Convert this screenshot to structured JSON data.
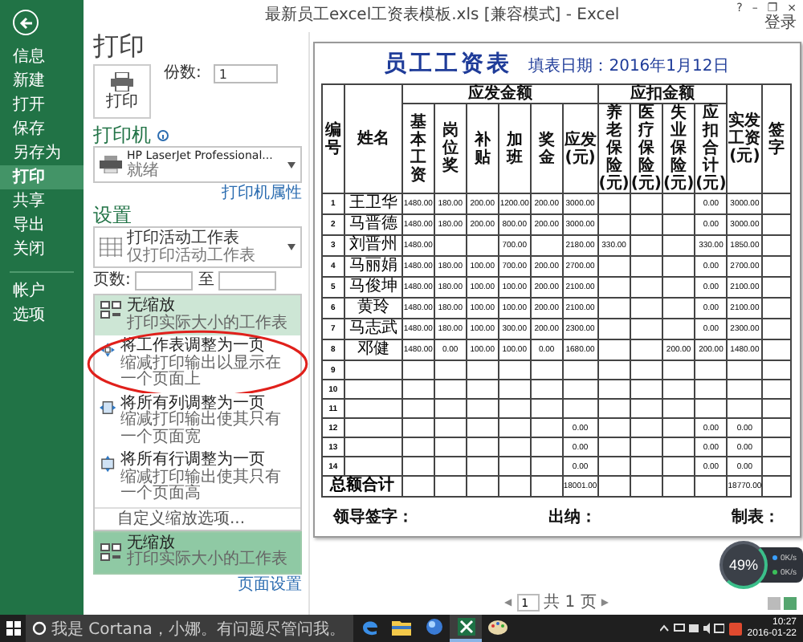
{
  "window": {
    "title": "最新员工excel工资表模板.xls [兼容模式] - Excel",
    "controls": [
      "?",
      "–",
      "❐",
      "×"
    ],
    "sign_in": "登录"
  },
  "nav": {
    "items": [
      {
        "label": "信息",
        "selected": false
      },
      {
        "label": "新建",
        "selected": false
      },
      {
        "label": "打开",
        "selected": false
      },
      {
        "label": "保存",
        "selected": false
      },
      {
        "label": "另存为",
        "selected": false
      },
      {
        "label": "打印",
        "selected": true
      },
      {
        "label": "共享",
        "selected": false
      },
      {
        "label": "导出",
        "selected": false
      },
      {
        "label": "关闭",
        "selected": false
      }
    ],
    "bottom_items": [
      {
        "label": "帐户",
        "selected": false
      },
      {
        "label": "选项",
        "selected": false
      }
    ]
  },
  "print": {
    "title": "打印",
    "button": "打印",
    "copies_label": "份数:",
    "copies": "1",
    "printer_heading": "打印机",
    "printer": {
      "name": "HP LaserJet Professional...",
      "status": "就绪"
    },
    "printer_link": "打印机属性",
    "settings_heading": "设置",
    "scope": {
      "title": "打印活动工作表",
      "subtitle": "仅打印活动工作表"
    },
    "pages_label": "页数:",
    "pages_to": "至",
    "scaling_menu": {
      "items": [
        {
          "kind": "none",
          "title": "无缩放",
          "description": "打印实际大小的工作表",
          "selected": true,
          "circled": false
        },
        {
          "kind": "fit_sheet",
          "title": "将工作表调整为一页",
          "description": "缩减打印输出以显示在一个页面上",
          "selected": false,
          "circled": true
        },
        {
          "kind": "fit_columns",
          "title": "将所有列调整为一页",
          "description": "缩减打印输出使其只有一个页面宽",
          "selected": false,
          "circled": false
        },
        {
          "kind": "fit_rows",
          "title": "将所有行调整为一页",
          "description": "缩减打印输出使其只有一个页面高",
          "selected": false,
          "circled": false
        }
      ],
      "custom": "自定义缩放选项..."
    },
    "scaling": {
      "title": "无缩放",
      "description": "打印实际大小的工作表",
      "open": true
    },
    "page_setup_link": "页面设置"
  },
  "sheet": {
    "title": "员工工资表",
    "subtitle": "填表日期：2016年1月12日",
    "header": [
      {
        "label": "编号"
      },
      {
        "label": "姓名"
      },
      {
        "label": "应发金额",
        "columns": [
          "基本工资",
          "岗位奖",
          "补贴",
          "加班",
          "奖金",
          "应发(元)"
        ]
      },
      {
        "label": "应扣金额",
        "columns": [
          "养老保险(元)",
          "医疗保险(元)",
          "失业保险(元)",
          "应扣合计(元)"
        ]
      },
      {
        "label": "实发工资(元)"
      },
      {
        "label": "签字"
      }
    ],
    "rows": [
      {
        "cells": [
          "1",
          "王卫华",
          "1480.00",
          "180.00",
          "200.00",
          "1200.00",
          "200.00",
          "3000.00",
          null,
          null,
          null,
          "0.00",
          "3000.00",
          null
        ]
      },
      {
        "cells": [
          "2",
          "马晋德",
          "1480.00",
          "180.00",
          "200.00",
          "800.00",
          "200.00",
          "3000.00",
          null,
          null,
          null,
          "0.00",
          "3000.00",
          null
        ]
      },
      {
        "cells": [
          "3",
          "刘晋州",
          "1480.00",
          null,
          null,
          "700.00",
          null,
          "2180.00",
          "330.00",
          null,
          null,
          "330.00",
          "1850.00",
          null
        ]
      },
      {
        "cells": [
          "4",
          "马丽娟",
          "1480.00",
          "180.00",
          "100.00",
          "700.00",
          "200.00",
          "2700.00",
          null,
          null,
          null,
          "0.00",
          "2700.00",
          null
        ]
      },
      {
        "cells": [
          "5",
          "马俊坤",
          "1480.00",
          "180.00",
          "100.00",
          "100.00",
          "200.00",
          "2100.00",
          null,
          null,
          null,
          "0.00",
          "2100.00",
          null
        ]
      },
      {
        "cells": [
          "6",
          "黄玲",
          "1480.00",
          "180.00",
          "100.00",
          "100.00",
          "200.00",
          "2100.00",
          null,
          null,
          null,
          "0.00",
          "2100.00",
          null
        ]
      },
      {
        "cells": [
          "7",
          "马志武",
          "1480.00",
          "180.00",
          "100.00",
          "300.00",
          "200.00",
          "2300.00",
          null,
          null,
          null,
          "0.00",
          "2300.00",
          null
        ]
      },
      {
        "cells": [
          "8",
          "邓健",
          "1480.00",
          "0.00",
          "100.00",
          "100.00",
          "0.00",
          "1680.00",
          null,
          null,
          "200.00",
          "200.00",
          "1480.00",
          null
        ]
      },
      {
        "cells": [
          "9",
          null,
          null,
          null,
          null,
          null,
          null,
          null,
          null,
          null,
          null,
          null,
          null,
          null
        ]
      },
      {
        "cells": [
          "10",
          null,
          null,
          null,
          null,
          null,
          null,
          null,
          null,
          null,
          null,
          null,
          null,
          null
        ]
      },
      {
        "cells": [
          "11",
          null,
          null,
          null,
          null,
          null,
          null,
          null,
          null,
          null,
          null,
          null,
          null,
          null
        ]
      },
      {
        "cells": [
          "12",
          null,
          null,
          null,
          null,
          null,
          null,
          "0.00",
          null,
          null,
          null,
          "0.00",
          "0.00",
          null
        ]
      },
      {
        "cells": [
          "13",
          null,
          null,
          null,
          null,
          null,
          null,
          "0.00",
          null,
          null,
          null,
          "0.00",
          "0.00",
          null
        ]
      },
      {
        "cells": [
          "14",
          null,
          null,
          null,
          null,
          null,
          null,
          "0.00",
          null,
          null,
          null,
          "0.00",
          "0.00",
          null
        ]
      }
    ],
    "total": {
      "label": "总额合计",
      "cells": [
        null,
        null,
        null,
        null,
        null,
        "18001.00",
        null,
        null,
        null,
        null,
        "18770.00",
        null
      ]
    },
    "signatures": [
      "领导签字：",
      "出纳：",
      "制表："
    ]
  },
  "page_nav": {
    "prev": "◀",
    "page": "1",
    "total": "共 1 页",
    "next": "▶"
  },
  "monitor": {
    "percent": "49%",
    "upload": "0K/s",
    "download": "0K/s"
  },
  "taskbar": {
    "search": "我是 Cortana，小娜。有问题尽管问我。",
    "apps": [
      {
        "kind": "edge",
        "active": false
      },
      {
        "kind": "folder",
        "active": false
      },
      {
        "kind": "globe",
        "active": false
      },
      {
        "kind": "excel",
        "active": true
      },
      {
        "kind": "paint",
        "active": false
      }
    ],
    "time": "10:27",
    "date": "2016-01-22"
  }
}
